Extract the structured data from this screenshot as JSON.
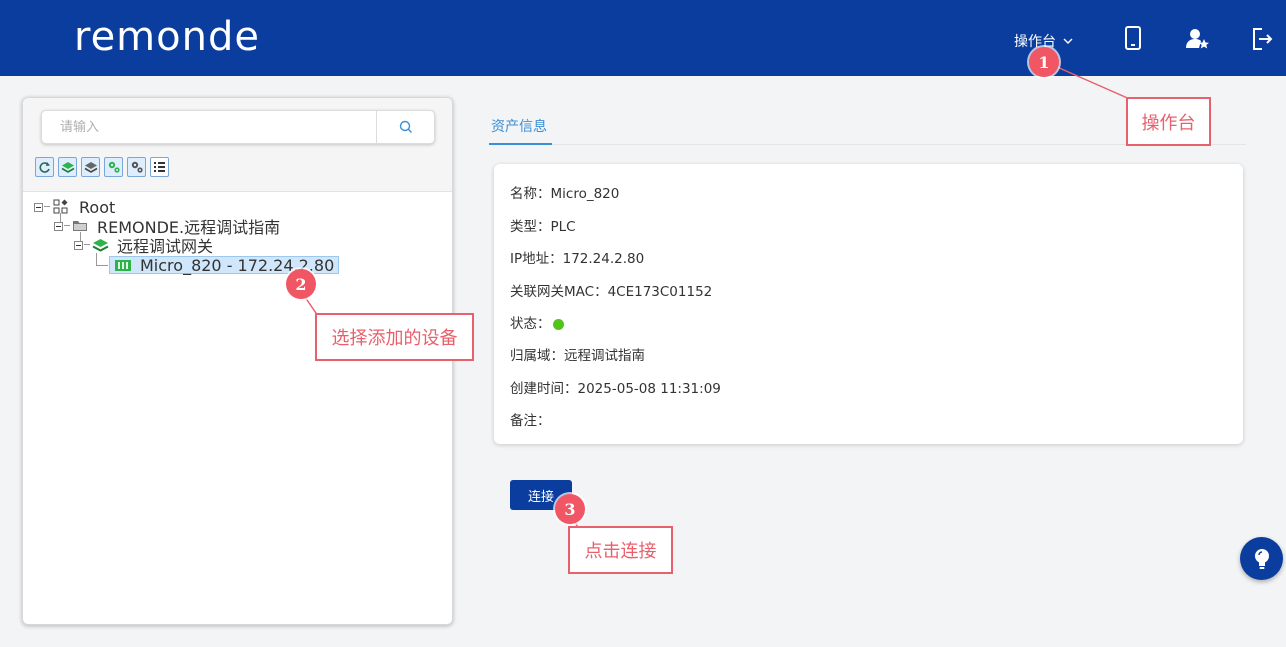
{
  "header": {
    "logo_text": "remonde",
    "menu_label": "操作台",
    "icons": [
      "mobile-icon",
      "user-star-icon",
      "logout-icon"
    ]
  },
  "left": {
    "search_placeholder": "请输入",
    "toolbar_icons": [
      "refresh-icon",
      "layer-green-icon",
      "layer-gray-icon",
      "gear-green-icon",
      "gear-gray-icon",
      "list-icon"
    ],
    "tree": {
      "root": "Root",
      "domain": "REMONDE.远程调试指南",
      "gateway": "远程调试网关",
      "device": "Micro_820 - 172.24.2.80"
    }
  },
  "main": {
    "tab": "资产信息",
    "info": {
      "name": "名称：Micro_820",
      "type": "类型：PLC",
      "ip": "IP地址：172.24.2.80",
      "mac": "关联网关MAC：4CE173C01152",
      "status_label": "状态：",
      "domain": "归属域：远程调试指南",
      "created": "创建时间：2025-05-08 11:31:09",
      "note": "备注："
    },
    "connect_label": "连接"
  },
  "colors": {
    "brand": "#0a3d9e",
    "accent": "#3b8fd6",
    "annotation": "#e8606c",
    "status_online": "#52c41a"
  },
  "annotations": [
    {
      "num": "1",
      "text": "操作台"
    },
    {
      "num": "2",
      "text": "选择添加的设备"
    },
    {
      "num": "3",
      "text": "点击连接"
    }
  ]
}
